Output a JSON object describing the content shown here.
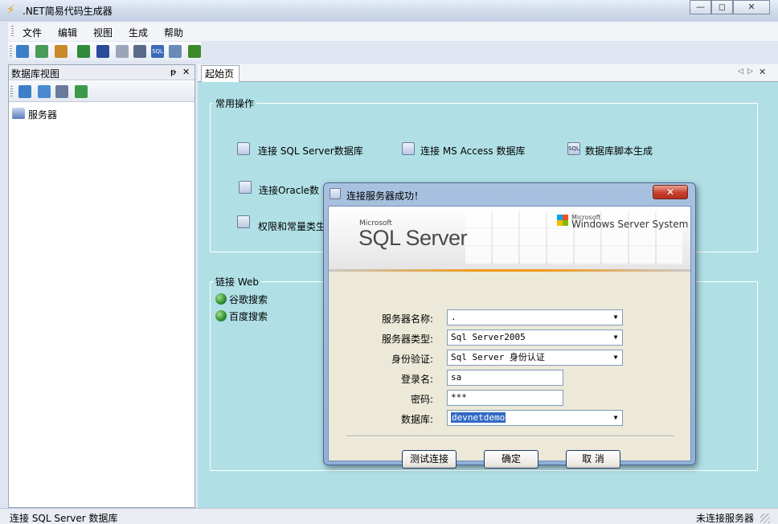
{
  "window": {
    "title": ".NET简易代码生成器",
    "minimize": "—",
    "restore": "◻",
    "close": "✕"
  },
  "menu": [
    "文件",
    "编辑",
    "视图",
    "生成",
    "帮助"
  ],
  "left_panel": {
    "title": "数据库视图",
    "pin": "ᵽ",
    "close": "✕",
    "tree_root": "服务器"
  },
  "tabs": [
    {
      "label": "起始页"
    }
  ],
  "tab_nav": {
    "prev": "◁",
    "next": "▷",
    "close": "✕"
  },
  "start_page": {
    "common_ops": {
      "label": "常用操作",
      "items": [
        "连接 SQL Server数据库",
        "连接 MS Access 数据库",
        "数据库脚本生成",
        "连接Oracle数",
        "权限和常量类生"
      ]
    },
    "web_links": {
      "label": "链接 Web",
      "items": [
        "谷歌搜索",
        "百度搜索"
      ]
    }
  },
  "status": {
    "left": "连接 SQL Server 数据库",
    "right": "未连接服务器"
  },
  "dialog": {
    "title": "连接服务器成功！",
    "close": "✕",
    "banner_left_small": "Microsoft",
    "banner_left_big": "SQL Server",
    "banner_right_small": "Microsoft",
    "banner_right_big": "Windows Server System",
    "fields": [
      {
        "label": "服务器名称:",
        "value": ".",
        "dropdown": true
      },
      {
        "label": "服务器类型:",
        "value": "Sql Server2005",
        "dropdown": true
      },
      {
        "label": "身份验证:",
        "value": "Sql Server 身份认证",
        "dropdown": true
      },
      {
        "label": "登录名:",
        "value": "sa",
        "dropdown": false
      },
      {
        "label": "密码:",
        "value": "***",
        "dropdown": false
      },
      {
        "label": "数据库:",
        "value": "devnetdemo",
        "dropdown": true
      }
    ],
    "buttons": {
      "test": "测试连接",
      "ok": "确定",
      "cancel": "取 消"
    }
  }
}
